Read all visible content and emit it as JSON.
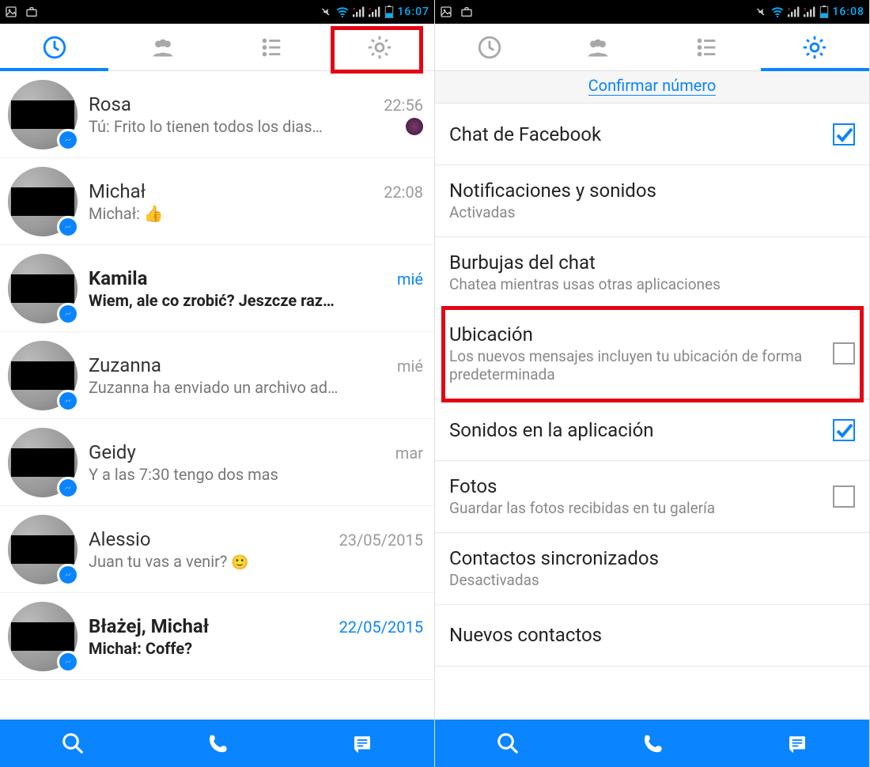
{
  "left": {
    "status_time": "16:07",
    "tabs_active": "recent",
    "conversations": [
      {
        "name": "Rosa",
        "time": "22:56",
        "preview": "Tú: Frito lo tienen todos los dias…",
        "unread": false,
        "has_tiny_avatar": true
      },
      {
        "name": "Michał",
        "time": "22:08",
        "preview": "Michał: ",
        "unread": false,
        "has_thumbs": true
      },
      {
        "name": "Kamila",
        "time": "mié",
        "preview": "Wiem, ale co zrobić? Jeszcze raz…",
        "unread": true
      },
      {
        "name": "Zuzanna",
        "time": "mié",
        "preview": "Zuzanna ha enviado un archivo ad…",
        "unread": false
      },
      {
        "name": "Geidy",
        "time": "mar",
        "preview": "Y a las 7:30 tengo dos mas",
        "unread": false
      },
      {
        "name": "Alessio",
        "time": "23/05/2015",
        "preview": "Juan tu vas a venir? ",
        "unread": false,
        "has_emoji": true
      },
      {
        "name": "Błażej, Michał",
        "time": "22/05/2015",
        "preview": "Michał: Coffe?",
        "unread": true
      }
    ]
  },
  "right": {
    "status_time": "16:08",
    "confirm_link": "Confirmar número",
    "settings": [
      {
        "title": "Chat de Facebook",
        "sub": "",
        "has_checkbox": true,
        "checked": true
      },
      {
        "title": "Notificaciones y sonidos",
        "sub": "Activadas"
      },
      {
        "title": "Burbujas del chat",
        "sub": "Chatea mientras usas otras aplicaciones"
      },
      {
        "title": "Ubicación",
        "sub": "Los nuevos mensajes incluyen tu ubicación de forma predeterminada",
        "has_checkbox": true,
        "checked": false,
        "highlighted": true
      },
      {
        "title": "Sonidos en la aplicación",
        "sub": "",
        "has_checkbox": true,
        "checked": true
      },
      {
        "title": "Fotos",
        "sub": "Guardar las fotos recibidas en tu galería",
        "has_checkbox": true,
        "checked": false
      },
      {
        "title": "Contactos sincronizados",
        "sub": "Desactivadas"
      },
      {
        "title": "Nuevos contactos",
        "sub": ""
      }
    ]
  }
}
